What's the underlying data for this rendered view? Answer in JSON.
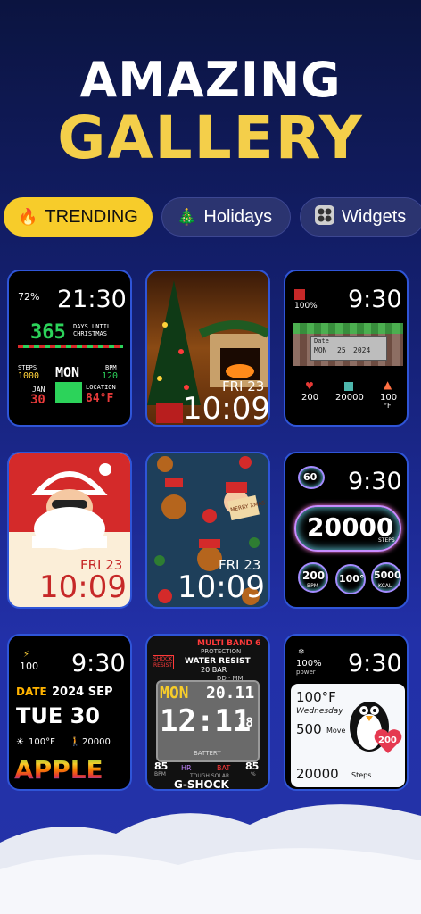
{
  "header": {
    "line1": "AMAZING",
    "line2": "GALLERY"
  },
  "tabs": [
    {
      "label": "TRENDING",
      "icon": "fire-icon"
    },
    {
      "label": "Holidays",
      "icon": "christmas-tree-icon"
    },
    {
      "label": "Widgets",
      "icon": "widgets-icon"
    }
  ],
  "cards": {
    "xmas_pixel": {
      "battery": "72%",
      "time": "21:30",
      "days": "365",
      "days_label": "DAYS UNTIL CHRISTMAS",
      "steps_label": "STEPS",
      "steps": "1000",
      "day": "MON",
      "bpm_label": "BPM",
      "bpm": "120",
      "month": "JAN",
      "date": "30",
      "location_label": "LOCATION",
      "temp": "84°F"
    },
    "tree": {
      "date": "FRI 23",
      "time": "10:09"
    },
    "minecraft": {
      "battery": "100%",
      "time": "9:30",
      "date_label": "Date",
      "d1": "MON",
      "d2": "25",
      "d3": "2024",
      "hearts": "200",
      "steps": "20000",
      "temp": "100",
      "temp_unit": "°F"
    },
    "santa": {
      "date": "FRI 23",
      "time": "10:09"
    },
    "pattern": {
      "date": "FRI 23",
      "time": "10:09",
      "sign": "MERRY XMAS"
    },
    "bubbles": {
      "battery": "60",
      "time": "9:30",
      "steps": "20000",
      "steps_label": "STEPS",
      "bpm": "200",
      "bpm_label": "BPM",
      "temp": "100°",
      "kcal": "5000",
      "kcal_label": "KCAL"
    },
    "retro": {
      "battery": "100",
      "time": "9:30",
      "date_label": "DATE",
      "year_month": "2024 SEP",
      "day": "TUE 30",
      "temp": "100°F",
      "steps": "20000",
      "brand": "APPLE"
    },
    "gshock": {
      "band": "MULTI BAND 6",
      "protection": "PROTECTION",
      "shock": "SHOCK RESIST",
      "water": "WATER RESIST",
      "bar": "20 BAR",
      "dd": "DD · MM",
      "day": "MON",
      "date": "20.11",
      "time": "12:11",
      "secs": "28",
      "battery": "BATTERY",
      "left_num": "85",
      "right_num": "85",
      "hr": "HR",
      "bat": "BAT",
      "bpm": "BPM",
      "pct": "%",
      "solar": "TOUGH SOLAR",
      "brand": "G-SHOCK"
    },
    "penguin": {
      "battery": "100%",
      "battery_label": "power",
      "time": "9:30",
      "temp": "100°F",
      "day": "Wednesday",
      "move": "500",
      "move_label": "Move",
      "heart": "200",
      "steps": "20000",
      "steps_label": "Steps"
    }
  },
  "colors": {
    "accent": "#f7cc2a",
    "card_border": "#2f55d8",
    "gold": "#f4cf4a"
  }
}
